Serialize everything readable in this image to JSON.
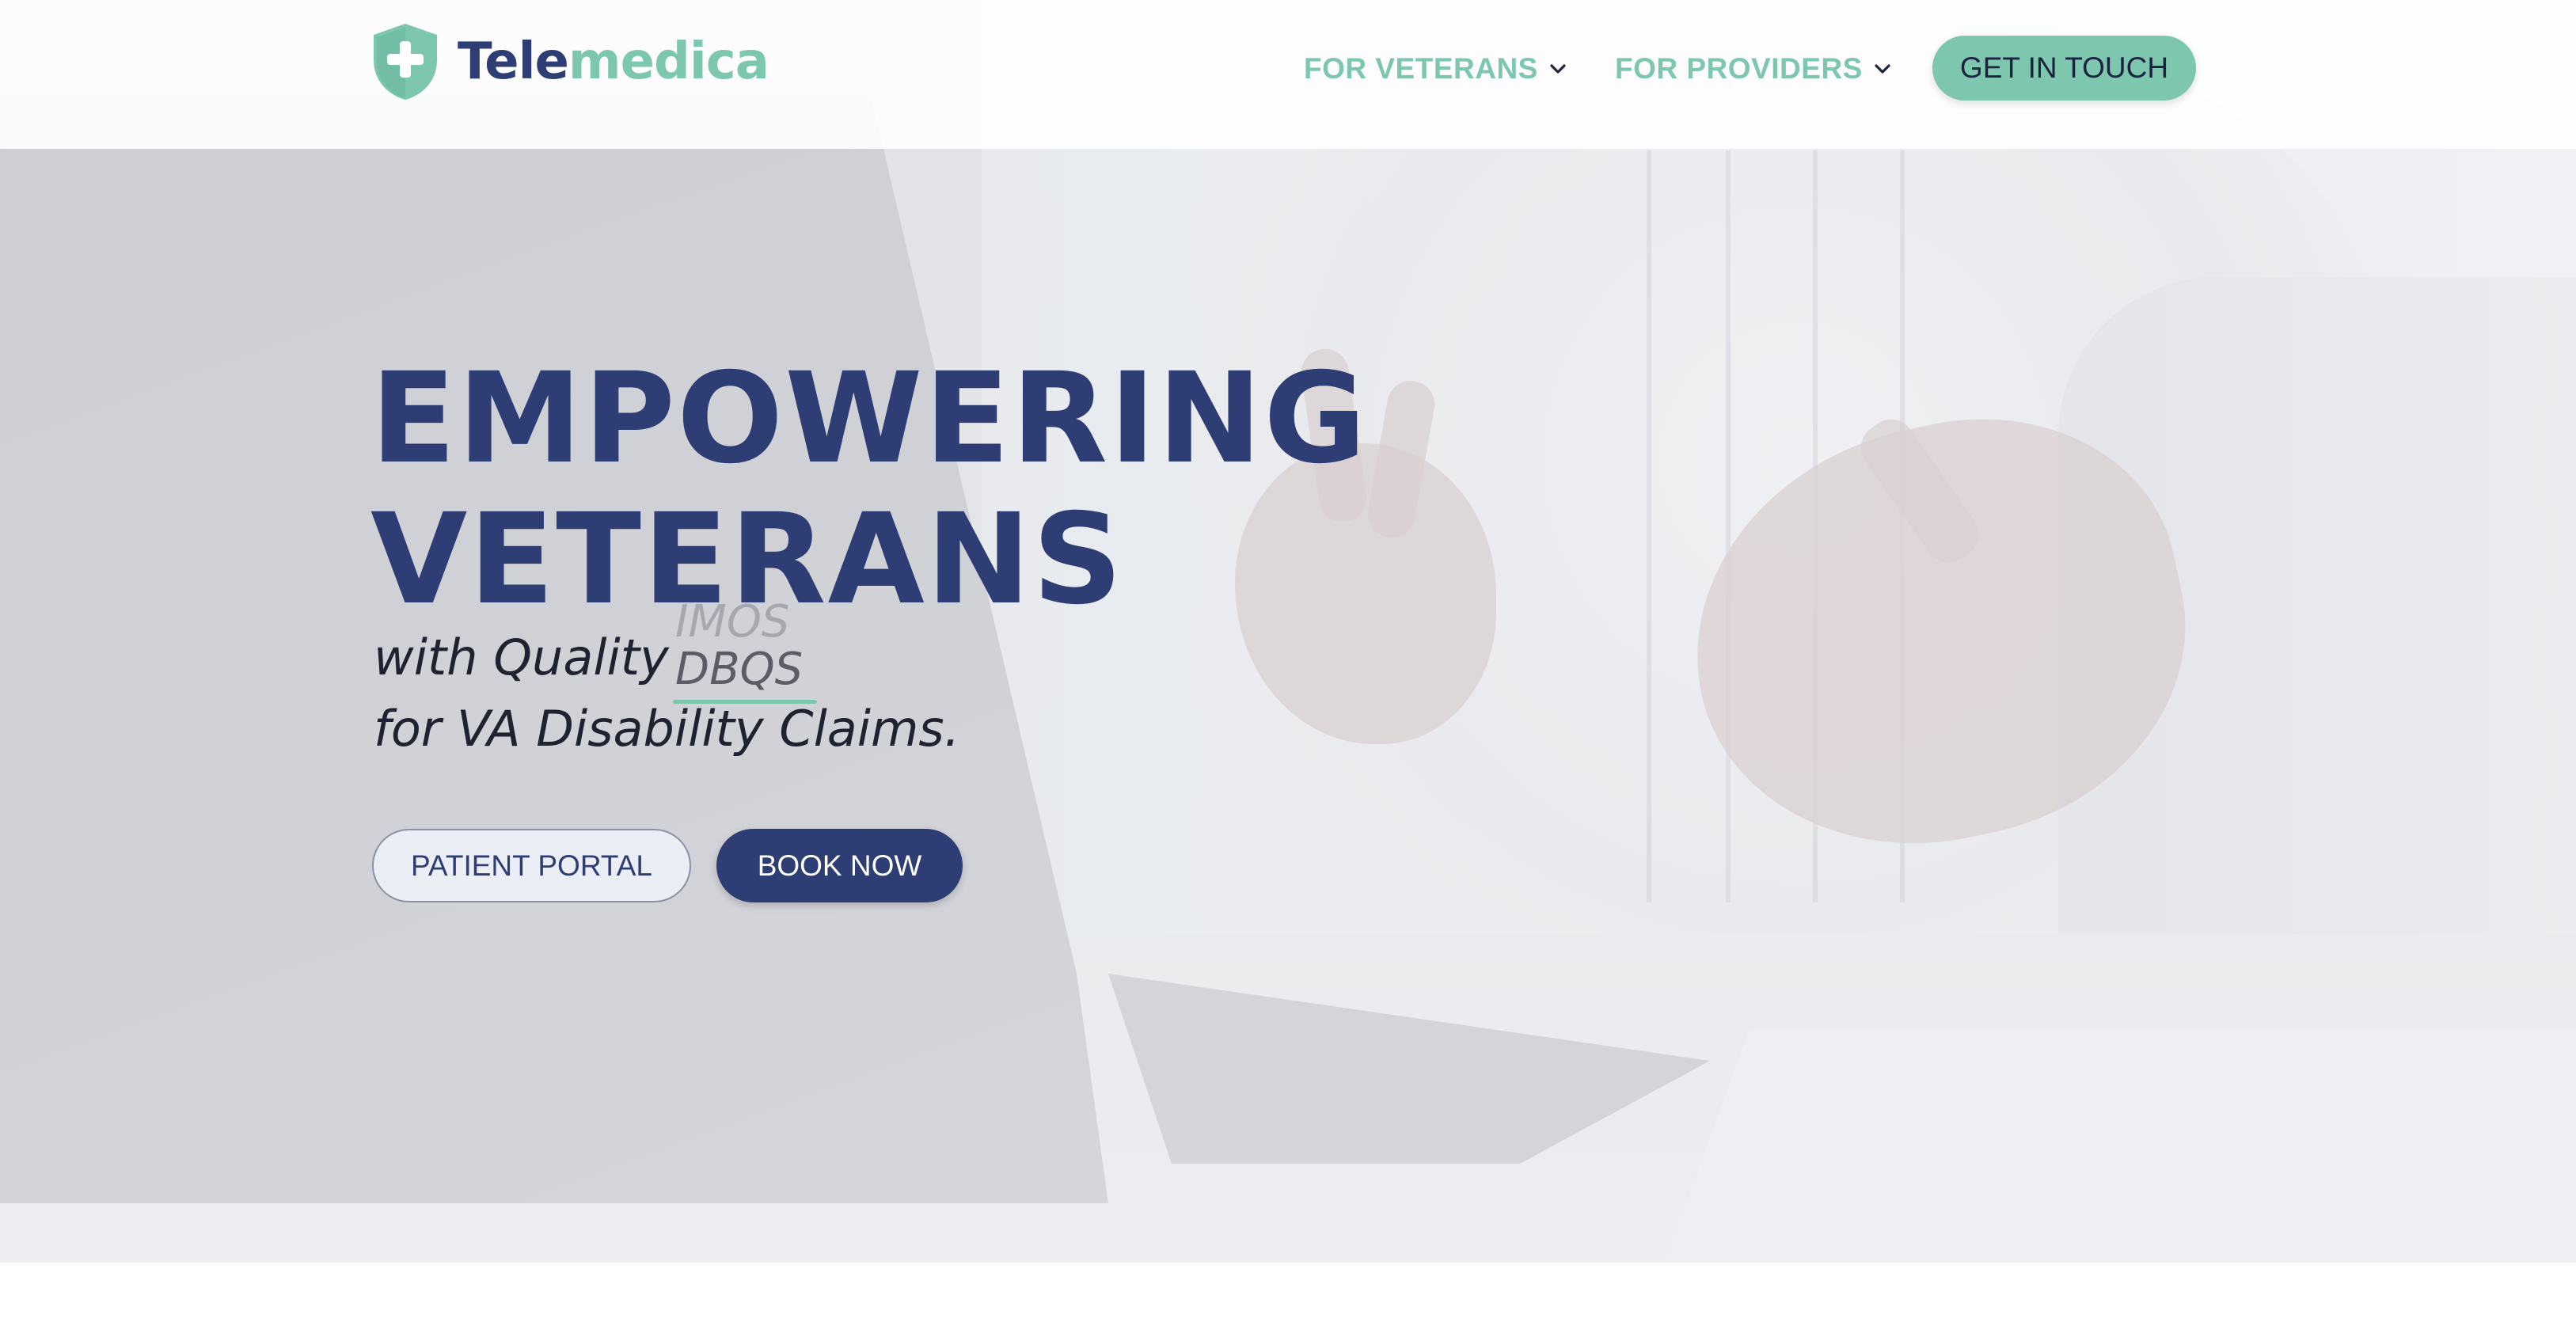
{
  "brand": {
    "name_part1": "Tele",
    "name_part2": "medica",
    "logo_icon": "shield-plus-icon",
    "colors": {
      "navy": "#2e3d73",
      "mint": "#7cc7ae"
    }
  },
  "nav": {
    "items": [
      {
        "label": "FOR VETERANS",
        "icon": "chevron-down-icon"
      },
      {
        "label": "FOR PROVIDERS",
        "icon": "chevron-down-icon"
      }
    ],
    "cta_label": "GET IN TOUCH"
  },
  "hero": {
    "headline_line1": "EMPOWERING",
    "headline_line2": "VETERANS",
    "tagline_prefix": "with Quality",
    "rotating_words": [
      "IMOS",
      "DBQS"
    ],
    "tagline_line2": "for VA Disability Claims.",
    "buttons": {
      "portal": "PATIENT PORTAL",
      "book": "BOOK NOW"
    }
  }
}
